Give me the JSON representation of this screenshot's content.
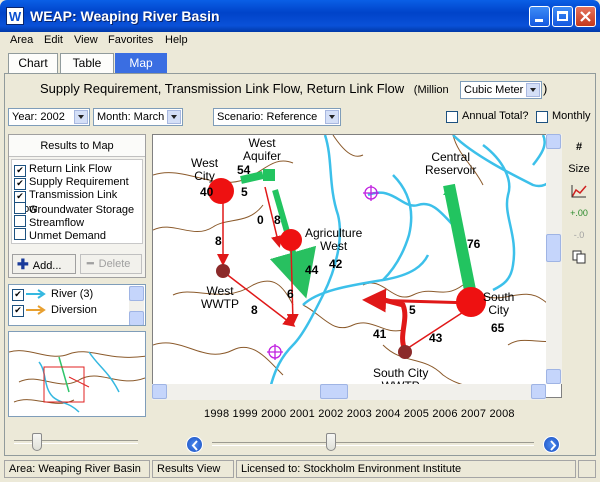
{
  "window": {
    "title": "WEAP: Weaping River Basin",
    "icon_letter": "W"
  },
  "menu": [
    "Area",
    "Edit",
    "View",
    "Favorites",
    "Help"
  ],
  "tabs": [
    {
      "label": "Chart"
    },
    {
      "label": "Table"
    },
    {
      "label": "Map",
      "active": true
    }
  ],
  "heading": {
    "title": "Supply Requirement, Transmission Link Flow, Return Link Flow",
    "unit_prefix": "(Million",
    "unit_value": "Cubic Meter"
  },
  "controls": {
    "year": "Year: 2002",
    "month": "Month: March",
    "scenario": "Scenario: Reference",
    "annual_total": "Annual Total?",
    "monthly": "Monthly"
  },
  "results_panel": {
    "header": "Results to Map",
    "items": [
      {
        "label": "Return Link Flow",
        "checked": true
      },
      {
        "label": "Supply Requirement",
        "checked": true
      },
      {
        "label": "Transmission Link Flow",
        "checked": true
      },
      {
        "label": "Groundwater Storage",
        "checked": false
      },
      {
        "label": "Streamflow",
        "checked": false
      },
      {
        "label": "Unmet Demand",
        "checked": false
      }
    ],
    "add_label": "Add...",
    "delete_label": "Delete"
  },
  "legend": [
    {
      "label": "River (3)"
    },
    {
      "label": "Diversion"
    }
  ],
  "map": {
    "nodes": {
      "west_aquifer": "West\nAquifer",
      "west_city": "West\nCity",
      "west_city_value": "40",
      "agriculture_west": "Agriculture\nWest",
      "agriculture_west_value": "42",
      "west_wwtp": "West\nWWTP",
      "central_reservoir": "Central\nReservoir",
      "south_city": "South\nCity",
      "south_city_value": "65",
      "south_city_wwtp": "South City\nWWTP"
    },
    "link_values": [
      "54",
      "5",
      "0",
      "8",
      "8",
      "44",
      "6",
      "8",
      "76",
      "5",
      "41",
      "43"
    ]
  },
  "right_tools": [
    "#",
    "Size"
  ],
  "years": [
    "1998",
    "1999",
    "2000",
    "2001",
    "2002",
    "2003",
    "2004",
    "2005",
    "2006",
    "2007",
    "2008"
  ],
  "timeline_current": "2002",
  "status": {
    "area": "Area: Weaping River Basin",
    "view": "Results View",
    "license": "Licensed to: Stockholm Environment Institute"
  }
}
